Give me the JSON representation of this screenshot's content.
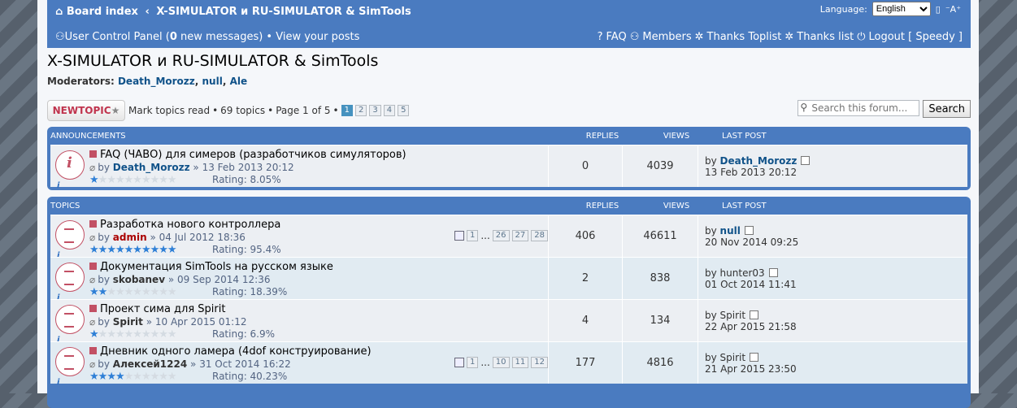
{
  "header": {
    "board_index": "Board index",
    "separator": "‹",
    "forum_name": "X-SIMULATOR и RU-SIMULATOR & SimTools",
    "language_label": "Language:",
    "language_value": "English",
    "font_size_label": "⁻A⁺",
    "ucp_label": "User Control Panel",
    "ucp_open": " (",
    "new_messages_count": "0",
    "new_messages_text": " new messages)",
    "bullet": " • ",
    "view_posts": "View your posts",
    "faq": "FAQ",
    "members": "Members",
    "thanks_toplist": "Thanks Toplist",
    "thanks_list": "Thanks list",
    "logout": "Logout [ Speedy ]"
  },
  "page_title": "X-SIMULATOR и RU-SIMULATOR & SimTools",
  "moderators": {
    "label": "Moderators:",
    "names": [
      "Death_Morozz",
      "null",
      "Ale"
    ],
    "comma": ","
  },
  "actions": {
    "new_topic": "NEWTOPIC",
    "new_topic_star": "★",
    "mark_read": "Mark topics read",
    "bullet": "•",
    "topics_count": "69 topics",
    "page_info": "Page 1 of 5",
    "pages": [
      "1",
      "2",
      "3",
      "4",
      "5"
    ],
    "search_placeholder": "Search this forum...",
    "search_button": "Search"
  },
  "announcements": {
    "header": {
      "title": "ANNOUNCEMENTS",
      "replies": "REPLIES",
      "views": "VIEWS",
      "last_post": "LAST POST"
    },
    "rows": [
      {
        "title": "FAQ (ЧАВО) для симеров (разработчиков симуляторов)",
        "by": "by",
        "author": "Death_Morozz",
        "date": "» 13 Feb 2013 20:12",
        "stars_on": 1,
        "rating": "Rating: 8.05%",
        "replies": "0",
        "views": "4039",
        "last_by": "by",
        "last_author": "Death_Morozz",
        "last_date": "13 Feb 2013 20:12"
      }
    ]
  },
  "topics": {
    "header": {
      "title": "TOPICS",
      "replies": "REPLIES",
      "views": "VIEWS",
      "last_post": "LAST POST"
    },
    "rows": [
      {
        "title": "Разработка нового контроллера",
        "by": "by",
        "author": "admin",
        "date": "» 04 Jul 2012 18:36",
        "stars_on": 10,
        "rating": "Rating: 95.4%",
        "pages": [
          "1",
          "...",
          "26",
          "27",
          "28"
        ],
        "replies": "406",
        "views": "46611",
        "last_by": "by",
        "last_author": "null",
        "last_date": "20 Nov 2014 09:25"
      },
      {
        "title": "Документация SimTools на русском языке",
        "by": "by",
        "author": "skobanev",
        "date": "» 09 Sep 2014 12:36",
        "stars_on": 2,
        "rating": "Rating: 18.39%",
        "replies": "2",
        "views": "838",
        "last_by": "by",
        "last_author": "hunter03",
        "last_date": "01 Oct 2014 11:41"
      },
      {
        "title": "Проект сима для Spirit",
        "by": "by",
        "author": "Spirit",
        "date": "» 10 Apr 2015 01:12",
        "stars_on": 1,
        "rating": "Rating: 6.9%",
        "replies": "4",
        "views": "134",
        "last_by": "by",
        "last_author": "Spirit",
        "last_date": "22 Apr 2015 21:58"
      },
      {
        "title": "Дневник одного ламера (4dof конструирование)",
        "by": "by",
        "author": "Алексей1224",
        "date": "» 31 Oct 2014 16:22",
        "stars_on": 4,
        "rating": "Rating: 40.23%",
        "pages": [
          "1",
          "...",
          "10",
          "11",
          "12"
        ],
        "replies": "177",
        "views": "4816",
        "last_by": "by",
        "last_author": "Spirit",
        "last_date": "21 Apr 2015 23:50"
      }
    ]
  },
  "colors": {
    "header_blue": "#4a7bc0",
    "link_blue": "#105289",
    "admin_red": "#aa0000",
    "star_blue": "#2e7fd6"
  }
}
